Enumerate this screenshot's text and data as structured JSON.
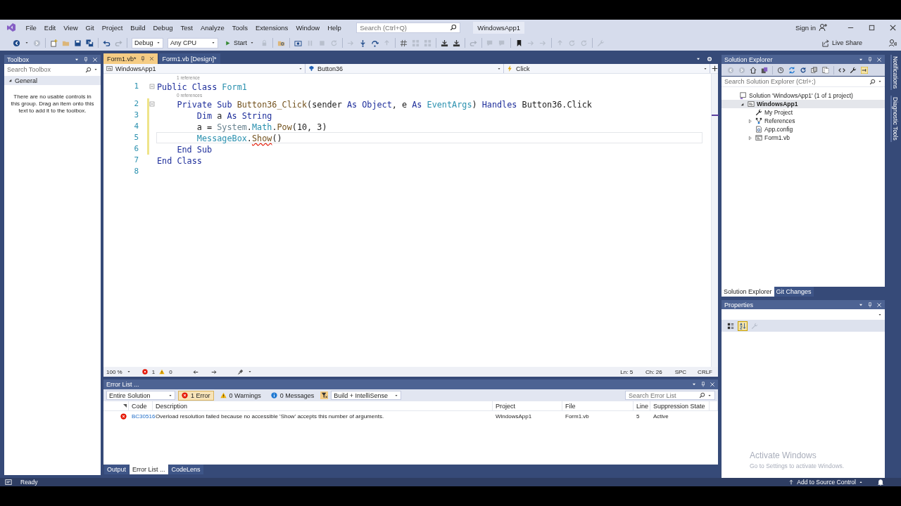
{
  "menu_bar": {
    "items": [
      "File",
      "Edit",
      "View",
      "Git",
      "Project",
      "Build",
      "Debug",
      "Test",
      "Analyze",
      "Tools",
      "Extensions",
      "Window",
      "Help"
    ],
    "search": {
      "placeholder": "Search (Ctrl+Q)"
    },
    "solution_name": "WindowsApp1",
    "sign_in": "Sign in"
  },
  "toolbar": {
    "configuration": "Debug",
    "platform": "Any CPU",
    "start": "Start",
    "live_share": "Live Share"
  },
  "toolbox": {
    "title": "Toolbox",
    "search": {
      "placeholder": "Search Toolbox"
    },
    "group": {
      "label": "General",
      "expanded": true
    },
    "empty_message": "There are no usable controls in this group. Drag an item onto this text to add it to the toolbox."
  },
  "editor": {
    "tabs": [
      {
        "label": "Form1.vb*",
        "selected": true
      },
      {
        "label": "Form1.vb [Design]*",
        "selected": false
      }
    ],
    "nav": [
      "WindowsApp1",
      "Button36",
      "Click"
    ],
    "lines": [
      {
        "number": "1",
        "codelens": "1 reference",
        "collapsible": true,
        "modified": false,
        "current": false,
        "tokens": [
          {
            "text": "Public Class ",
            "kind": "keyword"
          },
          {
            "text": "Form1",
            "kind": "class"
          }
        ]
      },
      {
        "number": "2",
        "codelens": "0 references",
        "collapsible": true,
        "modified": true,
        "current": false,
        "tokens": [
          {
            "text": "    Private Sub ",
            "kind": "keyword"
          },
          {
            "text": "Button36_Click",
            "kind": "method"
          },
          {
            "text": "(sender ",
            "kind": "plain"
          },
          {
            "text": "As Object",
            "kind": "keyword"
          },
          {
            "text": ", e ",
            "kind": "plain"
          },
          {
            "text": "As ",
            "kind": "keyword"
          },
          {
            "text": "EventArgs",
            "kind": "class"
          },
          {
            "text": ") ",
            "kind": "plain"
          },
          {
            "text": "Handles ",
            "kind": "keyword"
          },
          {
            "text": "Button36.Click",
            "kind": "plain"
          }
        ]
      },
      {
        "number": "3",
        "collapsible": false,
        "modified": true,
        "current": false,
        "tokens": [
          {
            "text": "        Dim ",
            "kind": "keyword"
          },
          {
            "text": "a ",
            "kind": "plain"
          },
          {
            "text": "As String",
            "kind": "keyword"
          }
        ]
      },
      {
        "number": "4",
        "collapsible": false,
        "modified": true,
        "current": false,
        "tokens": [
          {
            "text": "        a = ",
            "kind": "plain"
          },
          {
            "text": "System",
            "kind": "namespace"
          },
          {
            "text": ".",
            "kind": "plain"
          },
          {
            "text": "Math",
            "kind": "class"
          },
          {
            "text": ".",
            "kind": "plain"
          },
          {
            "text": "Pow",
            "kind": "method"
          },
          {
            "text": "(10, 3)",
            "kind": "plain"
          }
        ]
      },
      {
        "number": "5",
        "collapsible": false,
        "modified": true,
        "current": true,
        "tokens": [
          {
            "text": "        MessageBox",
            "kind": "class"
          },
          {
            "text": ".",
            "kind": "plain"
          },
          {
            "text": "Show",
            "kind": "error"
          },
          {
            "text": "()",
            "kind": "plain"
          }
        ]
      },
      {
        "number": "6",
        "collapsible": false,
        "modified": true,
        "current": false,
        "tokens": [
          {
            "text": "    End Sub",
            "kind": "keyword"
          }
        ]
      },
      {
        "number": "7",
        "collapsible": false,
        "modified": false,
        "current": false,
        "tokens": [
          {
            "text": "End Class",
            "kind": "keyword"
          }
        ]
      },
      {
        "number": "8",
        "collapsible": false,
        "modified": false,
        "current": false
      }
    ],
    "status": {
      "zoom": "100 %",
      "errors": "1",
      "warnings": "0",
      "line": "Ln: 5",
      "column": "Ch: 26",
      "indent": "SPC",
      "line_ending": "CRLF"
    }
  },
  "error_list": {
    "title": "Error List ...",
    "scope": "Entire Solution",
    "filters": [
      {
        "kind": "error",
        "label": "1 Error",
        "selected": true
      },
      {
        "kind": "warning",
        "label": "0 Warnings",
        "selected": false
      },
      {
        "kind": "message",
        "label": "0 Messages",
        "selected": false
      }
    ],
    "source": "Build + IntelliSense",
    "search": {
      "placeholder": "Search Error List"
    },
    "columns": [
      "Code",
      "Description",
      "Project",
      "File",
      "Line",
      "Suppression State"
    ],
    "rows": [
      {
        "kind": "error",
        "code": "BC30516",
        "description": "Overload resolution failed because no accessible 'Show' accepts this number of arguments.",
        "project": "WindowsApp1",
        "file": "Form1.vb",
        "line": "5",
        "suppression": "Active"
      }
    ],
    "tabs": [
      {
        "label": "Output",
        "selected": false
      },
      {
        "label": "Error List ...",
        "selected": true
      },
      {
        "label": "CodeLens",
        "selected": false
      }
    ]
  },
  "solution_explorer": {
    "title": "Solution Explorer",
    "search": {
      "placeholder": "Search Solution Explorer (Ctrl+;)"
    },
    "tree": [
      {
        "label": "Solution 'WindowsApp1' (1 of 1 project)",
        "kind": "solution",
        "selected": false,
        "children": [
          {
            "label": "WindowsApp1",
            "kind": "project",
            "selected": true,
            "expanded": true,
            "children": [
              {
                "label": "My Project",
                "kind": "settings",
                "selected": false
              },
              {
                "label": "References",
                "kind": "references",
                "selected": false,
                "expanded": false
              },
              {
                "label": "App.config",
                "kind": "config",
                "selected": false
              },
              {
                "label": "Form1.vb",
                "kind": "form",
                "selected": false,
                "expanded": false
              }
            ]
          }
        ]
      }
    ],
    "tabs": [
      {
        "label": "Solution Explorer",
        "selected": true
      },
      {
        "label": "Git Changes",
        "selected": false
      }
    ]
  },
  "properties": {
    "title": "Properties",
    "buttons": [
      {
        "kind": "categorized",
        "selected": false
      },
      {
        "kind": "alphabetical",
        "selected": true
      },
      {
        "kind": "property-pages",
        "selected": false
      }
    ]
  },
  "side_tabs": [
    "Notifications",
    "Diagnostic Tools"
  ],
  "status_bar": {
    "text": "Ready",
    "source_control": "Add to Source Control"
  },
  "activation": {
    "title": "Activate Windows",
    "hint": "Go to Settings to activate Windows."
  }
}
